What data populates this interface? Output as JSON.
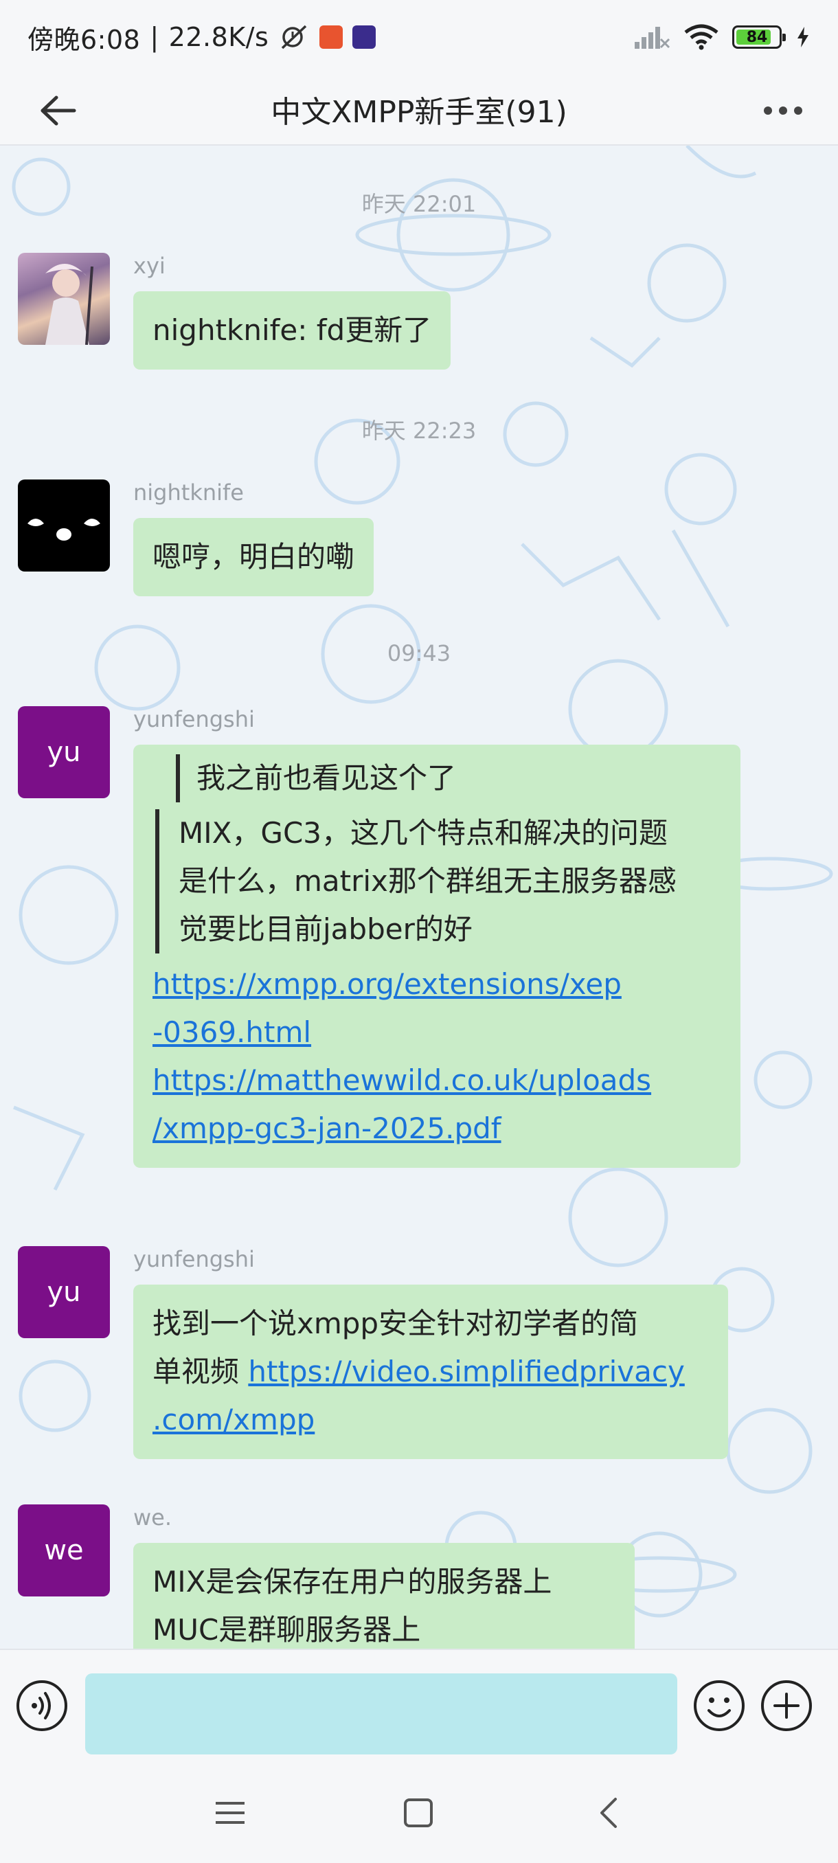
{
  "status_bar": {
    "time": "傍晚6:08",
    "net_speed": "22.8K/s",
    "battery": "84",
    "battery_level": 0.84
  },
  "header": {
    "title": "中文XMPP新手室(91)"
  },
  "messages": [
    {
      "timestamp": "昨天 22:01",
      "sender": "xyi",
      "text": "nightknife: fd更新了"
    },
    {
      "timestamp": "昨天 22:23",
      "sender": "nightknife",
      "text": "嗯哼，明白的嘞"
    },
    {
      "timestamp": "09:43",
      "sender": "yunfengshi",
      "avatar": "yu",
      "quote_head": "我之前也看见这个了",
      "quote_lines": [
        "MIX，GC3，这几个特点和解决的问题",
        "是什么，matrix那个群组无主服务器感",
        "觉要比目前jabber的好"
      ],
      "link_lines": [
        "https://xmpp.org/extensions/xep",
        "-0369.html",
        "https://matthewwild.co.uk/uploads",
        "/xmpp-gc3-jan-2025.pdf"
      ]
    },
    {
      "sender": "yunfengshi",
      "avatar": "yu",
      "line1": "找到一个说xmpp安全针对初学者的简",
      "line2_text": "单视频 ",
      "line2_link": "https://video.simplifiedprivacy",
      "line3_link": ".com/xmpp"
    },
    {
      "sender": "we.",
      "avatar": "we",
      "line1": "MIX是会保存在用户的服务器上",
      "line2": "MUC是群聊服务器上"
    }
  ],
  "input": {
    "placeholder": "",
    "value": ""
  },
  "colors": {
    "bubble": "#c9ecc8",
    "avatar_purple": "#7b0f88",
    "link": "#1a73d9",
    "input_bg": "#b9e9ee",
    "fab_arrow": "#8a1590"
  },
  "icons": {
    "back": "arrow-left-icon",
    "more": "more-dots-icon",
    "voice": "voice-icon",
    "emoji": "emoji-icon",
    "plus": "plus-icon",
    "scroll_down": "double-chevron-down-icon"
  }
}
